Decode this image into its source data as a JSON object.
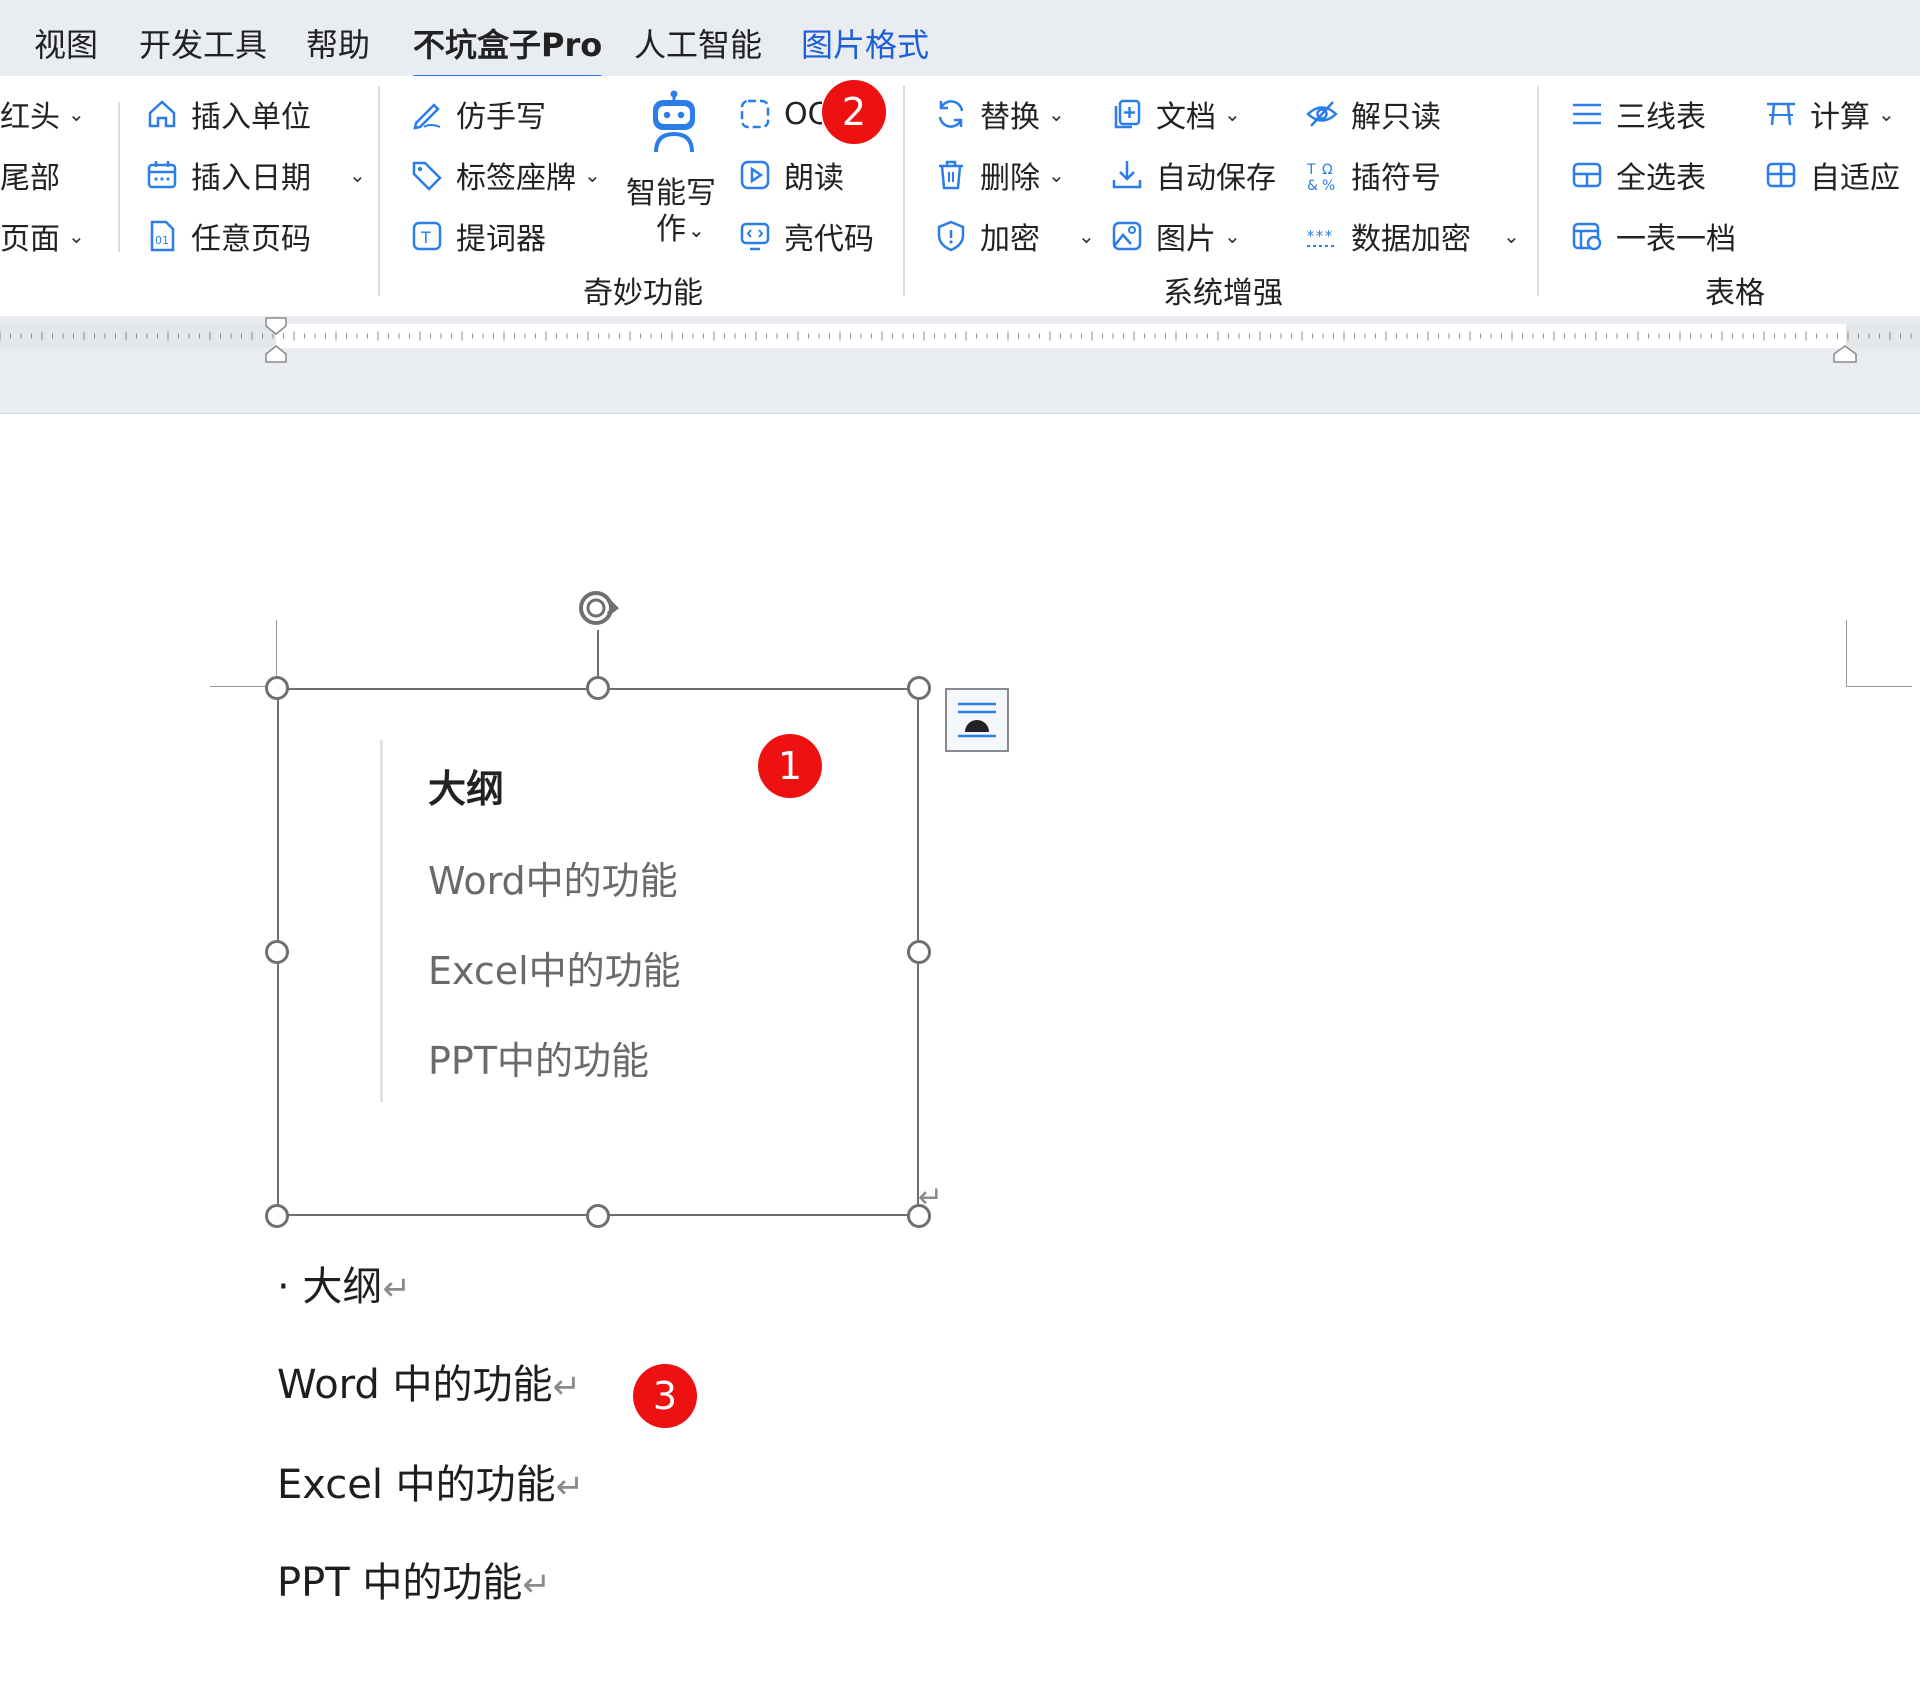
{
  "tabs": [
    {
      "label": "视图",
      "state": "normal"
    },
    {
      "label": "开发工具",
      "state": "normal"
    },
    {
      "label": "帮助",
      "state": "normal"
    },
    {
      "label": "不坑盒子Pro",
      "state": "active"
    },
    {
      "label": "人工智能",
      "state": "normal"
    },
    {
      "label": "图片格式",
      "state": "accent"
    }
  ],
  "ribbon": {
    "left_items": [
      "红头",
      "尾部",
      "页面"
    ],
    "insert_items": [
      "插入单位",
      "插入日期",
      "任意页码"
    ],
    "magic": {
      "items": [
        "仿手写",
        "标签座牌",
        "提词器"
      ],
      "ai_write": "智能写作",
      "right_items": [
        "OCR",
        "朗读",
        "亮代码"
      ],
      "group_label": "奇妙功能"
    },
    "system": {
      "col1": [
        "替换",
        "删除",
        "加密"
      ],
      "col2": [
        "文档",
        "自动保存",
        "图片"
      ],
      "col3": [
        "解只读",
        "插符号",
        "数据加密"
      ],
      "group_label": "系统增强"
    },
    "table": {
      "col1": [
        "三线表",
        "全选表",
        "一表一档"
      ],
      "col2": [
        "计算",
        "自适应"
      ],
      "group_label": "表格"
    }
  },
  "outline_box": {
    "title": "大纲",
    "items": [
      "Word中的功能",
      "Excel中的功能",
      "PPT中的功能"
    ]
  },
  "paragraphs": [
    "· 大纲",
    "Word 中的功能",
    "Excel 中的功能",
    "PPT 中的功能"
  ],
  "paragraph_mark": "↵",
  "badges": [
    "1",
    "2",
    "3"
  ],
  "colors": {
    "accent": "#2a6ff0",
    "badge": "#ee1111",
    "icon": "#2b7de9"
  }
}
